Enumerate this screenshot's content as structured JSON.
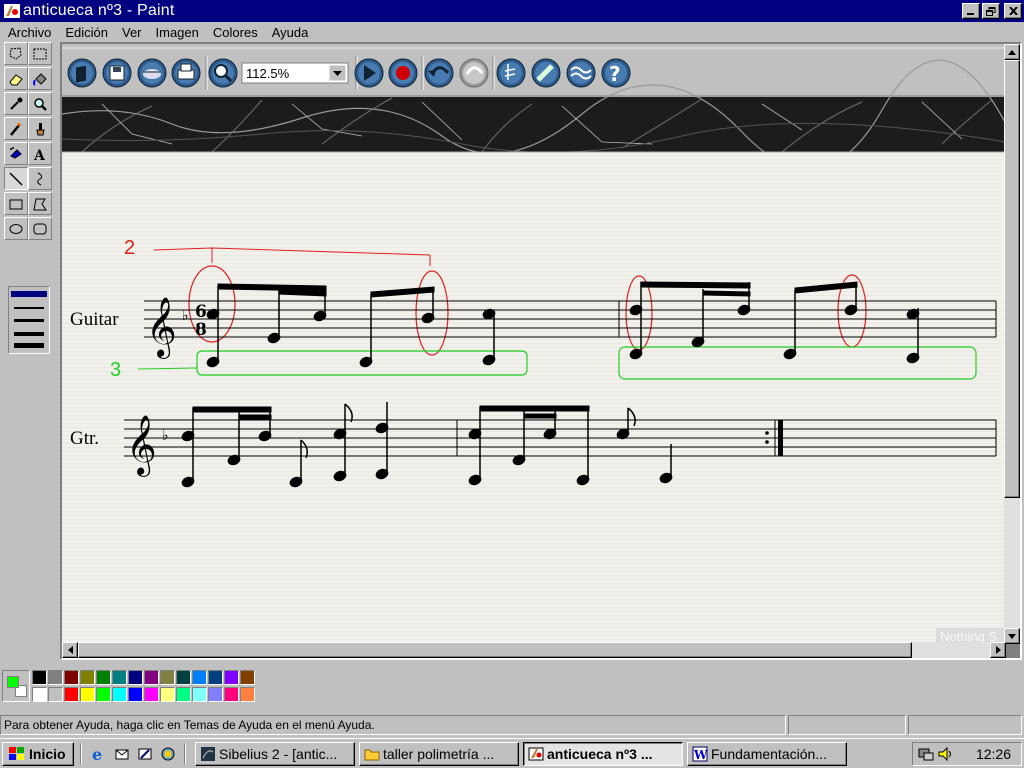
{
  "window": {
    "title": "anticueca nº3 - Paint"
  },
  "menu": [
    "Archivo",
    "Edición",
    "Ver",
    "Imagen",
    "Colores",
    "Ayuda"
  ],
  "sibelius_toolbar": {
    "zoom": "112.5%"
  },
  "score": {
    "annotation_2": "2",
    "annotation_3": "3",
    "staff1_name": "Guitar",
    "staff2_name": "Gtr.",
    "time_sig_top": "6",
    "time_sig_bottom": "8",
    "watermark": "Nothing S"
  },
  "status": {
    "help_text": "Para obtener Ayuda, haga clic en Temas de Ayuda en el menú Ayuda."
  },
  "taskbar": {
    "start": "Inicio",
    "tasks": [
      "Sibelius 2 - [antic...",
      "taller polimetría ...",
      "anticueca nº3 ...",
      "Fundamentación..."
    ],
    "clock": "12:26"
  },
  "colors": {
    "titlebar": "#000080",
    "annotation_red": "#e02020",
    "annotation_green": "#20d020",
    "foreground": "#00ff00",
    "background": "#ffffff"
  },
  "palette": {
    "row1": [
      "#000000",
      "#808080",
      "#800000",
      "#808000",
      "#008000",
      "#008080",
      "#000080",
      "#800080",
      "#808040",
      "#004040",
      "#0080ff",
      "#004080",
      "#8000ff",
      "#804000"
    ],
    "row2": [
      "#ffffff",
      "#c0c0c0",
      "#ff0000",
      "#ffff00",
      "#00ff00",
      "#00ffff",
      "#0000ff",
      "#ff00ff",
      "#ffff80",
      "#00ff80",
      "#80ffff",
      "#8080ff",
      "#ff0080",
      "#ff8040"
    ]
  }
}
